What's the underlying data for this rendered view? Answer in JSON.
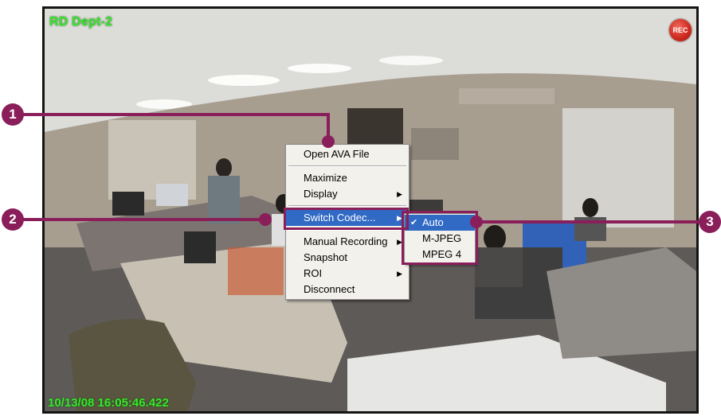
{
  "viewer": {
    "camera_name": "RD Dept-2",
    "timestamp": "10/13/08 16:05:46.422",
    "rec_label": "REC"
  },
  "context_menu": {
    "open_file": "Open AVA File",
    "maximize": "Maximize",
    "display": "Display",
    "switch_codec": "Switch Codec...",
    "manual_recording": "Manual Recording",
    "snapshot": "Snapshot",
    "roi": "ROI",
    "disconnect": "Disconnect",
    "submenu_arrow": "▶"
  },
  "codec_submenu": {
    "items": [
      "Auto",
      "M-JPEG",
      "MPEG 4"
    ],
    "selected": "Auto",
    "check_mark": "✔"
  },
  "callouts": [
    "1",
    "2",
    "3"
  ],
  "colors": {
    "accent": "#8a1e5a",
    "overlay_text": "#39e62c",
    "highlight": "#316ac5"
  }
}
